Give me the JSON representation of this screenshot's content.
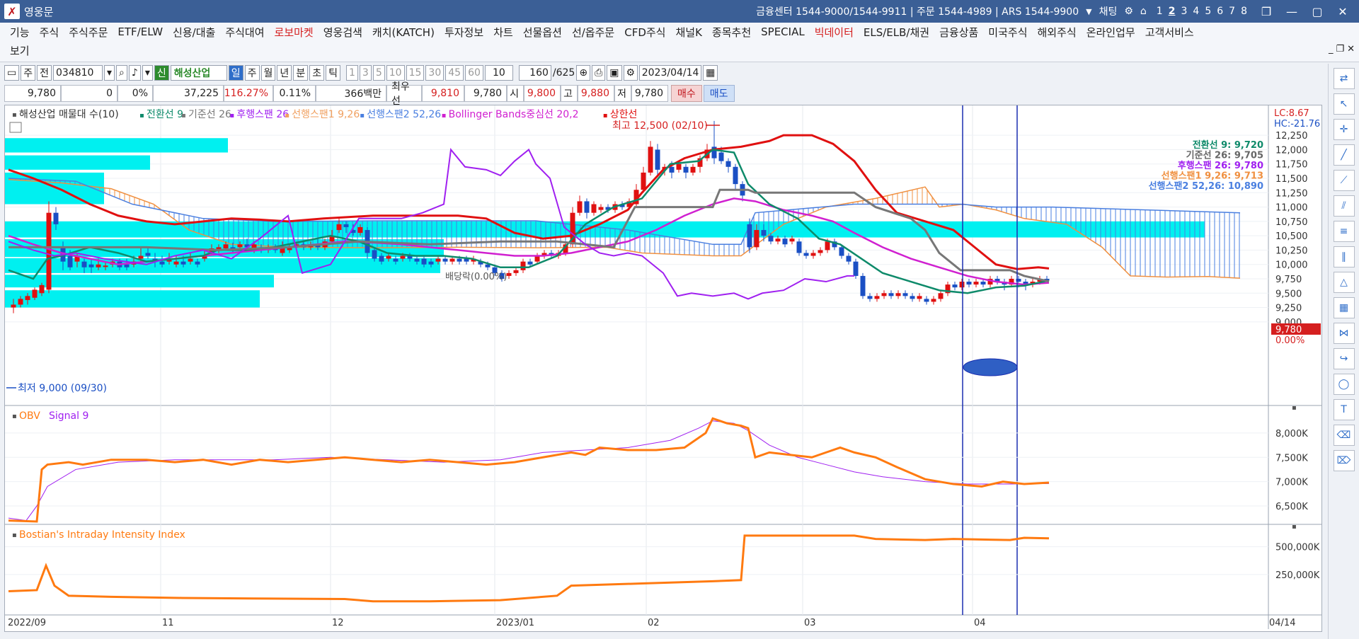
{
  "window": {
    "title": "영웅문",
    "info": "금융센터 1544-9000/1544-9911 | 주문 1544-4989 | ARS 1544-9900",
    "chat": "채팅",
    "pages": [
      "1",
      "2",
      "3",
      "4",
      "5",
      "6",
      "7",
      "8"
    ],
    "active_page": "2"
  },
  "menu": {
    "items": [
      "기능",
      "주식",
      "주식주문",
      "ETF/ELW",
      "신용/대출",
      "주식대여",
      "로보마켓",
      "영웅검색",
      "캐치(KATCH)",
      "투자정보",
      "차트",
      "선물옵션",
      "선/옵주문",
      "CFD주식",
      "채널K",
      "종목추천",
      "SPECIAL",
      "빅데이터",
      "ELS/ELB/채권",
      "금융상품",
      "미국주식",
      "해외주식",
      "온라인업무",
      "고객서비스"
    ],
    "red_items": [
      "로보마켓",
      "빅데이터"
    ],
    "row2": "보기"
  },
  "toolbar": {
    "mode1": "주",
    "mode2": "전",
    "code": "034810",
    "badge": "신",
    "stock": "해성산업",
    "periods": [
      "일",
      "주",
      "월",
      "년",
      "분",
      "초",
      "틱"
    ],
    "active_period": "일",
    "intervals": [
      "1",
      "3",
      "5",
      "10",
      "15",
      "30",
      "45",
      "60"
    ],
    "interval_select": "10",
    "count": "160",
    "count_total": "/625",
    "date": "2023/04/14"
  },
  "info": {
    "price": "9,780",
    "change": "0",
    "change_pct": "0%",
    "volume": "37,225",
    "vol_ratio": "116.27%",
    "turnover": "0.11%",
    "amount": "366백만",
    "best_sell_label": "최우선",
    "best_sell": "9,810",
    "best_buy": "9,780",
    "open_label": "시",
    "open": "9,800",
    "high_label": "고",
    "high": "9,880",
    "low_label": "저",
    "low": "9,780",
    "buy": "매수",
    "sell": "매도"
  },
  "legend": {
    "title": "해성산업 매물대 수(10)",
    "items": [
      {
        "label": "전환선 9",
        "color": "#0e8a6a"
      },
      {
        "label": "기준선 26",
        "color": "#777777"
      },
      {
        "label": "후행스팬 26",
        "color": "#a020f0"
      },
      {
        "label": "선행스팬1 9,26",
        "color": "#f0a060"
      },
      {
        "label": "선행스팬2 52,26",
        "color": "#4a7fe0"
      },
      {
        "label": "Bollinger Bands중심선 20,2",
        "color": "#d020d0"
      },
      {
        "label": "상한선",
        "color": "#e01010"
      }
    ]
  },
  "right_legend": [
    {
      "label": "전환선  9: 9,720",
      "color": "#0e8a6a"
    },
    {
      "label": "기준선  26: 9,705",
      "color": "#666666"
    },
    {
      "label": "후행스팬  26: 9,780",
      "color": "#a020f0"
    },
    {
      "label": "선행스팬1 9,26: 9,713",
      "color": "#f09040"
    },
    {
      "label": "선행스팬2 52,26: 10,890",
      "color": "#4a7fe0"
    }
  ],
  "lc_label": "LC:8.67",
  "hc_label": "HC:-21.76",
  "annotations": {
    "high": "최고 12,500 (02/10)",
    "low": "최저 9,000 (09/30)",
    "dividend": "배당락(0.00%)",
    "current_price": "9,780",
    "current_pct": "0.00%"
  },
  "price_axis": [
    "12,250",
    "12,000",
    "11,750",
    "11,500",
    "11,250",
    "11,000",
    "10,750",
    "10,500",
    "10,250",
    "10,000",
    "9,750",
    "9,500",
    "9,250",
    "9,000"
  ],
  "obv": {
    "label_a": "OBV",
    "label_b": "Signal 9",
    "axis": [
      "8,000K",
      "7,500K",
      "7,000K",
      "6,500K"
    ]
  },
  "bostian": {
    "label": "Bostian's Intraday Intensity Index",
    "axis": [
      "500,000K",
      "250,000K"
    ]
  },
  "x_axis": [
    "2022/09",
    "11",
    "12",
    "2023/01",
    "02",
    "03",
    "04",
    "04/14"
  ],
  "colors": {
    "titlebar": "#3b5f96",
    "up": "#e01010",
    "down": "#1a4fc4",
    "volume_profile": "#00f0f0",
    "upper_band": "#e01010",
    "middle_band": "#d020d0",
    "conversion": "#0e8a6a",
    "base": "#777777",
    "lagging": "#a020f0",
    "span1": "#f09040",
    "span2": "#4a7fe0",
    "obv": "#ff7a10"
  }
}
